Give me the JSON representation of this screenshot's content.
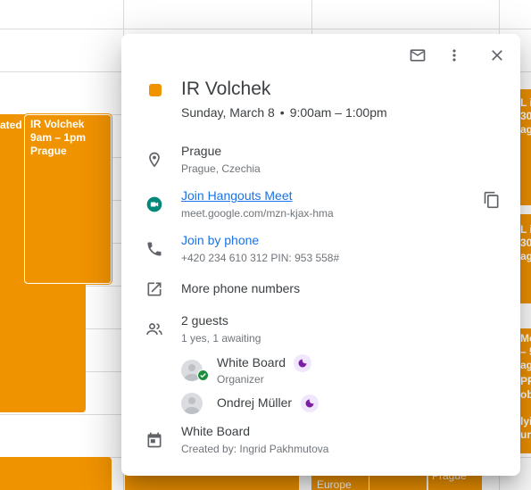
{
  "background": {
    "event_left_partial": "ated",
    "event_main": {
      "title": "IR Volchek",
      "time": "9am – 1pm",
      "location": "Prague"
    },
    "right_partials": [
      "L i",
      "30",
      "agu",
      "L i",
      "30",
      "agu",
      "Mo",
      "– 5",
      "agu",
      "PPl",
      "oba",
      "lyin",
      "uro"
    ],
    "bottom_labels": [
      "Europe",
      "Prague"
    ]
  },
  "popup": {
    "toolbar": {
      "email_icon": "email-icon",
      "more_icon": "more-vert-icon",
      "close_icon": "close-icon"
    },
    "color": "#f09300",
    "title": "IR Volchek",
    "date": "Sunday, March 8",
    "separator": "•",
    "time": "9:00am – 1:00pm",
    "location": {
      "name": "Prague",
      "detail": "Prague, Czechia"
    },
    "meet": {
      "label": "Join Hangouts Meet",
      "url": "meet.google.com/mzn-kjax-hma"
    },
    "phone": {
      "label": "Join by phone",
      "number": "+420 234 610 312 PIN: 953 558#"
    },
    "more_numbers": "More phone numbers",
    "guests": {
      "count": "2 guests",
      "summary": "1 yes, 1 awaiting",
      "list": [
        {
          "name": "White Board",
          "role": "Organizer"
        },
        {
          "name": "Ondrej Müller",
          "role": ""
        }
      ]
    },
    "calendar": {
      "name": "White Board",
      "creator": "Created by: Ingrid Pakhmutova"
    }
  }
}
